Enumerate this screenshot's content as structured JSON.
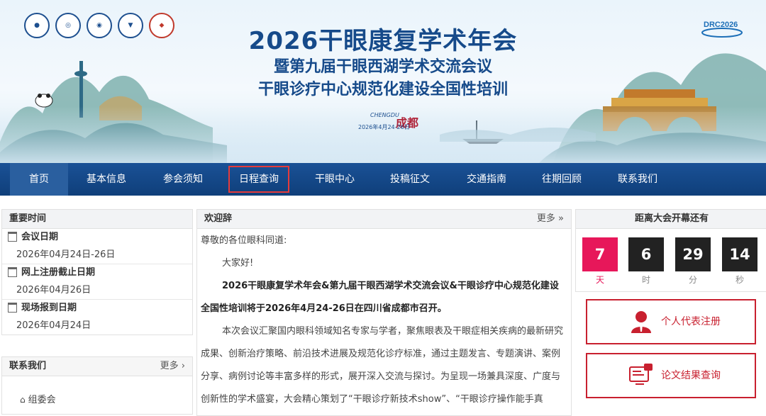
{
  "banner": {
    "title_line1": "2026干眼康复学术年会",
    "title_line2": "暨第九届干眼西湖学术交流会议",
    "title_line3": "干眼诊疗中心规范化建设全国性培训",
    "city": "CHENGDU",
    "seal": "成都",
    "date": "2026年4月24-26日",
    "drc_logo": "DRC2026"
  },
  "nav": {
    "items": [
      "首页",
      "基本信息",
      "参会须知",
      "日程查询",
      "干眼中心",
      "投稿征文",
      "交通指南",
      "往期回顾",
      "联系我们"
    ]
  },
  "important_dates": {
    "title": "重要时间",
    "items": [
      {
        "label": "会议日期",
        "value": "2026年04月24日-26日"
      },
      {
        "label": "网上注册截止日期",
        "value": "2026年04月26日"
      },
      {
        "label": "现场报到日期",
        "value": "2026年04月24日"
      }
    ]
  },
  "contact": {
    "title": "联系我们",
    "more": "更多 ›",
    "first_item": "组委会"
  },
  "welcome": {
    "title": "欢迎辞",
    "more": "更多 »",
    "greeting": "尊敬的各位眼科同道:",
    "hello": "大家好!",
    "bold_para": "2026干眼康复学术年会&第九届干眼西湖学术交流会议&干眼诊疗中心规范化建设全国性培训将于2026年4月24-26日在四川省成都市召开。",
    "para": "本次会议汇聚国内眼科领域知名专家与学者，聚焦眼表及干眼症相关疾病的最新研究成果、创新治疗策略、前沿技术进展及规范化诊疗标准，通过主题发言、专题演讲、案例分享、病例讨论等丰富多样的形式，展开深入交流与探讨。为呈现一场兼具深度、广度与创新性的学术盛宴，大会精心策划了“干眼诊疗新技术show”、“干眼诊疗操作能手真"
  },
  "countdown": {
    "title": "距离大会开幕还有",
    "values": [
      "7",
      "6",
      "29",
      "14"
    ],
    "units": [
      "天",
      "时",
      "分",
      "秒"
    ]
  },
  "actions": {
    "register": "个人代表注册",
    "paper_result": "论文结果查询"
  },
  "colors": {
    "nav_bg": "#12468a",
    "title_blue": "#164a8a",
    "accent_red": "#c8202f",
    "countdown_pink": "#e7175a"
  }
}
